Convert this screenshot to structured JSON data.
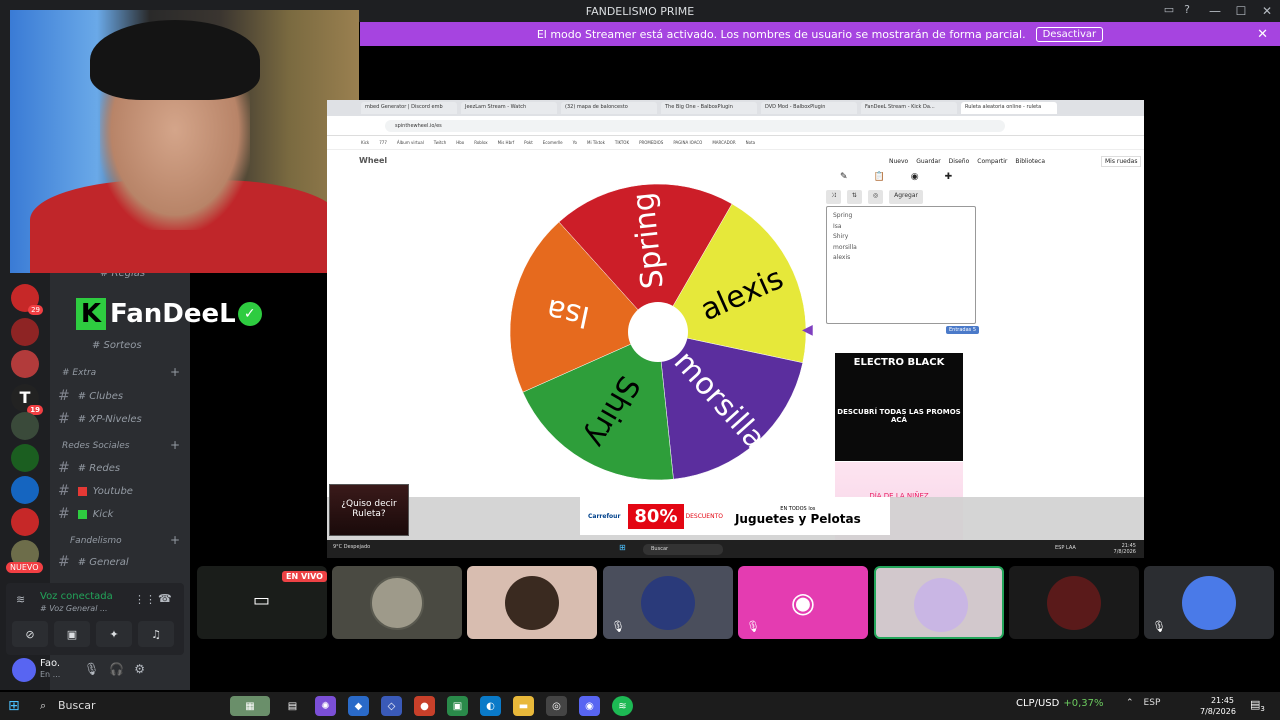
{
  "window": {
    "title": "FANDELISMO PRIME",
    "buttons": [
      "—",
      "☐",
      "✕"
    ],
    "icons": [
      "inbox-icon",
      "help-icon"
    ]
  },
  "streamer_banner": {
    "text": "El modo Streamer está activado. Los nombres de usuario se mostrarán de forma parcial.",
    "button": "Desactivar",
    "close": "✕"
  },
  "server_badges": {
    "s1": "29",
    "s2": "19"
  },
  "new_badge": "NUEVO",
  "channels": {
    "reglas": "# Reglas",
    "brand": "FanDeeL",
    "sorteos": "# Sorteos",
    "cat_extra": "# Extra",
    "clubes": "# Clubes",
    "xp": "# XP-Niveles",
    "cat_redes": "Redes Sociales",
    "redes": "# Redes",
    "youtube": "Youtube",
    "kick": "Kick",
    "cat_fandelismo": "Fandelismo",
    "general": "# General"
  },
  "voice": {
    "status": "Voz conectada",
    "channel": "# Voz General ..."
  },
  "user": {
    "name": "Fao.",
    "status": "En ..."
  },
  "browser": {
    "tabs": [
      "mbed Generator | Discord emb",
      "JeezLam Stream - Watch",
      "(32) mapa de baloncesto",
      "The Big One - BalboxPlugin",
      "DVD Mod - BalboxPlugin",
      "FanDeeL Stream - Kick Da...",
      "Ruleta aleatoria online - ruleta"
    ],
    "url": "spinthewheel.io/es",
    "bookmarks": [
      "Kick",
      "777",
      "Álbum virtual",
      "Twitch",
      "Hbo",
      "Roblox",
      "Mis Hbrf",
      "Pokt",
      "Ecomerlle",
      "Yo",
      "Mi Tiktok",
      "TIKTOK",
      "PROMEDIOS",
      "PAGINA IOACO",
      "MARCADOR",
      "Nota"
    ],
    "site_brand": "Wheel",
    "menu": [
      "Nuevo",
      "Guardar",
      "Diseño",
      "Compartir",
      "Biblioteca",
      "Mis ruedas"
    ]
  },
  "wheel": {
    "segments": [
      {
        "label": "alexis",
        "color": "#e6e83a"
      },
      {
        "label": "morsilla",
        "color": "#5b2e9e"
      },
      {
        "label": "Shiry",
        "color": "#2e9e3a"
      },
      {
        "label": "Isa",
        "color": "#e66a1e"
      },
      {
        "label": "Spring",
        "color": "#cc1e28"
      }
    ]
  },
  "editor": {
    "add_label": "Agregar",
    "entries": [
      "Spring",
      "Isa",
      "Shiry",
      "morsilla",
      "alexis"
    ],
    "count": "Entradas 5"
  },
  "ads": {
    "electro_title": "ELECTRO BLACK",
    "electro_sub": "DESCUBRÍ TODAS LAS PROMOS ACÁ",
    "dia": "DÍA DE LA NIÑEZ",
    "ruleta": "¿Quiso decir Ruleta?",
    "carrefour_brand": "Carrefour",
    "pct": "80%",
    "pct_sub": "DESCUENTO",
    "juguetes": "Juguetes y Pelotas",
    "juguetes_top": "EN TODOS los"
  },
  "inner_taskbar": {
    "weather": "9°C Despejado",
    "search": "Buscar",
    "time": "21:45",
    "date": "7/8/2026",
    "lang": "ESP LAA"
  },
  "live_badge": "EN VIVO",
  "taskbar": {
    "search": "Buscar",
    "fx_pair": "CLP/USD",
    "fx_change": "+0,37%",
    "lang": "ESP",
    "time": "21:45",
    "date": "7/8/2026",
    "notif_count": "3"
  }
}
